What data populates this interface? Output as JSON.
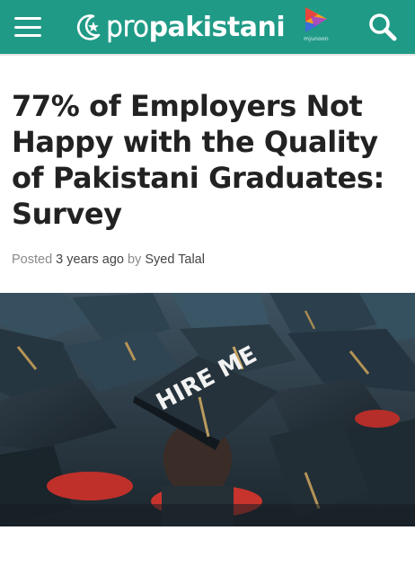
{
  "header": {
    "brand_pro": "pro",
    "brand_pakistani": "pakistani",
    "partner_text": "mjunoon",
    "colors": {
      "bar": "#1f9a86",
      "icon": "#ffffff"
    },
    "icons": {
      "menu": "hamburger-icon",
      "search": "search-icon",
      "brand": "crescent-star-icon",
      "partner": "play-triangle-icon"
    }
  },
  "article": {
    "title": "77% of Employers Not Happy with the Quality of Pakistani Graduates: Survey",
    "byline": {
      "posted_label": "Posted ",
      "time": "3 years ago",
      "by_label": " by ",
      "author": "Syed Talal"
    },
    "hero_image": {
      "cap_text": "HIRE ME"
    }
  }
}
